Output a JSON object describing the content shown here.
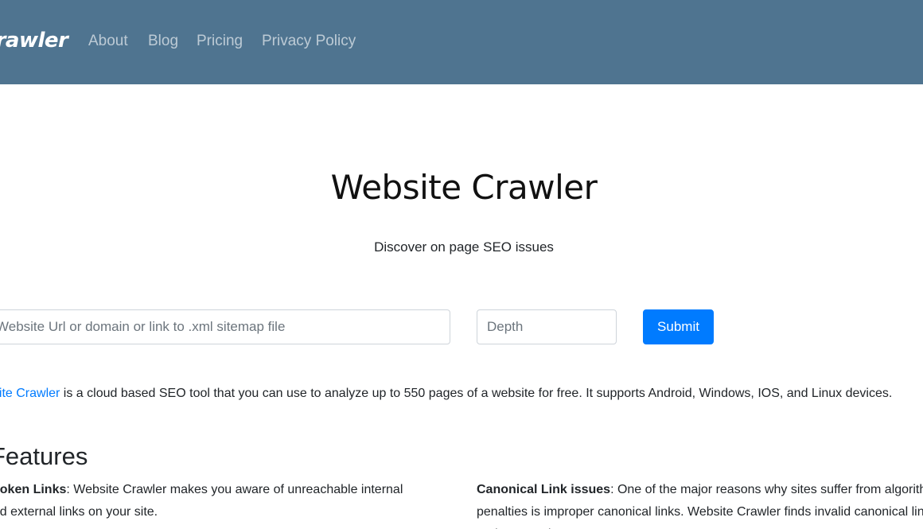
{
  "navbar": {
    "brand": "Crawler",
    "links": [
      "About",
      "Blog",
      "Pricing",
      "Privacy Policy"
    ]
  },
  "hero": {
    "title": "Website Crawler",
    "subtitle": "Discover on page SEO issues"
  },
  "form": {
    "url_placeholder": "Website Url or domain or link to .xml sitemap file",
    "depth_placeholder": "Depth",
    "submit_label": "Submit"
  },
  "intro": {
    "link_text": "bsite Crawler",
    "text": " is a cloud based SEO tool that you can use to analyze up to 550 pages of a website for free. It supports Android, Windows, IOS, and Linux devices."
  },
  "features": {
    "heading": "Features",
    "items": [
      {
        "title": "Broken Links",
        "text": ": Website Crawler makes you aware of unreachable internal and external links on your site."
      },
      {
        "title": "Canonical Link issues",
        "text": ": One of the major reasons why sites suffer from algorithm penalties is improper canonical links. Website Crawler finds invalid canonical links and reports them."
      }
    ]
  },
  "colors": {
    "navbar_bg": "#4f7490",
    "primary": "#007bff"
  }
}
